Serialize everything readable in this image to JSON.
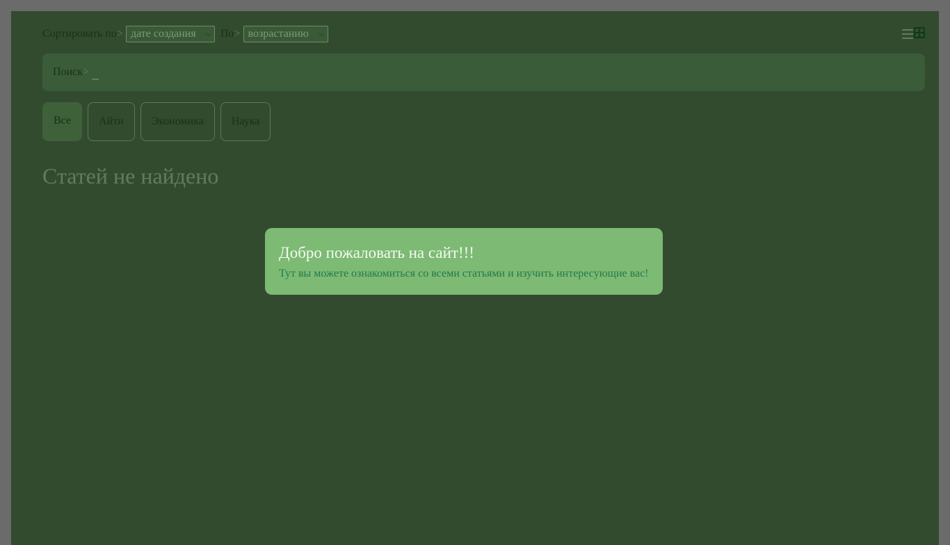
{
  "toolbar": {
    "sort_label": "Сортировать по",
    "sort_arrow": ">",
    "sort_value": "дате создания",
    "order_label": "По",
    "order_arrow": ">",
    "order_value": "возрастанию"
  },
  "view_toggle": {
    "list_icon": "list-icon",
    "grid_icon": "grid-icon"
  },
  "search": {
    "label": "Поиск",
    "arrow": ">",
    "value": ""
  },
  "filters": {
    "all": "Все",
    "it": "Айти",
    "economy": "Экономика",
    "science": "Наука"
  },
  "content": {
    "empty_message": "Статей не найдено"
  },
  "modal": {
    "title": "Добро пожаловать на сайт!!!",
    "text": "Тут вы можете ознакомиться со всеми статьями и изучить интересующие вас!"
  }
}
